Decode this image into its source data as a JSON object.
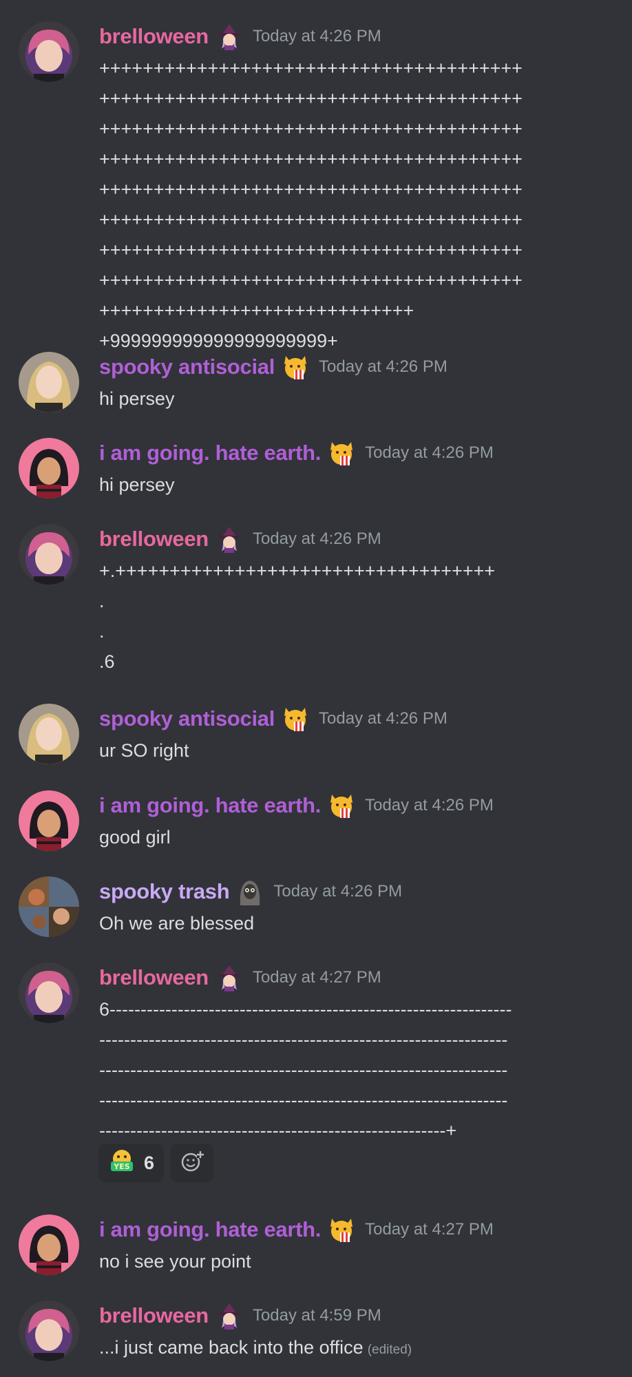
{
  "messages": [
    {
      "author": "brelloween",
      "role_icon": "witch-emoji-icon",
      "timestamp": "Today at 4:26 PM",
      "lines": [
        "+++++++++++++++++++++++++++++++++++++++",
        "+++++++++++++++++++++++++++++++++++++++",
        "+++++++++++++++++++++++++++++++++++++++",
        "+++++++++++++++++++++++++++++++++++++++",
        "+++++++++++++++++++++++++++++++++++++++",
        "+++++++++++++++++++++++++++++++++++++++",
        "+++++++++++++++++++++++++++++++++++++++",
        "+++++++++++++++++++++++++++++++++++++++",
        "+++++++++++++++++++++++++++++",
        "+999999999999999999999+"
      ]
    },
    {
      "author": "spooky antisocial",
      "role_icon": "popcorn-cat-icon",
      "timestamp": "Today at 4:26 PM",
      "lines": [
        "hi persey"
      ]
    },
    {
      "author": "i am going. hate earth.",
      "role_icon": "popcorn-cat-icon",
      "timestamp": "Today at 4:26 PM",
      "lines": [
        "hi persey"
      ]
    },
    {
      "author": "brelloween",
      "role_icon": "witch-emoji-icon",
      "timestamp": "Today at 4:26 PM",
      "lines": [
        "+.+++++++++++++++++++++++++++++++++++",
        ".",
        ".",
        ".6"
      ]
    },
    {
      "author": "spooky antisocial",
      "role_icon": "popcorn-cat-icon",
      "timestamp": "Today at 4:26 PM",
      "lines": [
        "ur SO right"
      ]
    },
    {
      "author": "i am going. hate earth.",
      "role_icon": "popcorn-cat-icon",
      "timestamp": "Today at 4:26 PM",
      "lines": [
        "good girl"
      ]
    },
    {
      "author": "spooky trash",
      "role_icon": "spooky-creature-icon",
      "timestamp": "Today at 4:26 PM",
      "lines": [
        "Oh we are blessed"
      ]
    },
    {
      "author": "brelloween",
      "role_icon": "witch-emoji-icon",
      "timestamp": "Today at 4:27 PM",
      "lines": [
        "6-----------------------------------------------------------------",
        "------------------------------------------------------------------",
        "------------------------------------------------------------------",
        "------------------------------------------------------------------",
        "--------------------------------------------------------+"
      ],
      "reaction": {
        "emoji": "yes-emoji-icon",
        "count": "6"
      }
    },
    {
      "author": "i am going. hate earth.",
      "role_icon": "popcorn-cat-icon",
      "timestamp": "Today at 4:27 PM",
      "lines": [
        "no i see your point"
      ]
    },
    {
      "author": "brelloween",
      "role_icon": "witch-emoji-icon",
      "timestamp": "Today at 4:59 PM",
      "lines": [
        "...i just came back into the office"
      ],
      "edited": "(edited)"
    }
  ],
  "colors": {
    "background": "#313338",
    "brelloween": "#e8689f",
    "purple_name": "#b05fd7",
    "spooky_trash": "#c9a9f5",
    "timestamp": "#949ba4",
    "text": "#dbdee1"
  }
}
